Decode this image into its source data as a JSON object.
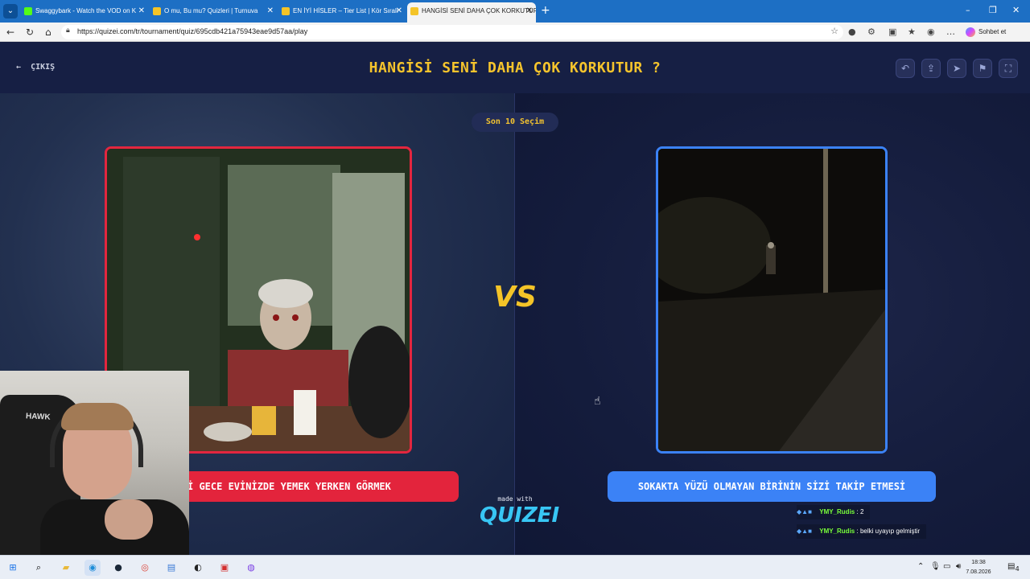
{
  "browser": {
    "tabs": [
      {
        "title": "Swaggybark - Watch the VOD on K",
        "favicon_color": "#53fc18"
      },
      {
        "title": "O mu, Bu mu? Quizleri | Turnuva",
        "favicon_color": "#f4c428"
      },
      {
        "title": "EN İYİ HİSLER – Tier List | Kör Sıralı",
        "favicon_color": "#f4c428"
      },
      {
        "title": "HANGİSİ SENİ DAHA ÇOK KORKUTUR",
        "favicon_color": "#f4c428"
      }
    ],
    "new_tab_glyph": "+",
    "url": "https://quizei.com/tr/tournament/quiz/695cdb421a75943eae9d57aa/play",
    "copilot_label": "Sohbet et",
    "window_controls": [
      "–",
      "❐",
      "✕"
    ]
  },
  "page": {
    "exit_label": "ÇIKIŞ",
    "title": "HANGİSİ SENİ DAHA ÇOK KORKUTUR ?",
    "header_actions": [
      "undo-icon",
      "share-icon",
      "send-icon",
      "flag-icon",
      "fullscreen-icon"
    ],
    "choice_count": "Son 10 Seçim",
    "vs_label": "VS",
    "left_option": {
      "label": "NE'Nİ GECE EVİNİZDE YEMEK YERKEN GÖRMEK",
      "color": "#e3243c"
    },
    "right_option": {
      "label": "SOKAKTA YÜZÜ OLMAYAN BİRİNİN SİZİ TAKİP ETMESİ",
      "color": "#3b82f6"
    },
    "made_with": "made with",
    "brand": "QUIZEI",
    "title_color": "#f6c42c"
  },
  "chat": [
    {
      "user": "YMY_Rudis",
      "message": "2"
    },
    {
      "user": "YMY_Rudis",
      "message": "belki uyayıp gelmiştir"
    }
  ],
  "webcam": {
    "chair_brand": "HAWK"
  },
  "taskbar": {
    "time": "18:38",
    "date": "7.08.2026",
    "notification_count": "4"
  }
}
